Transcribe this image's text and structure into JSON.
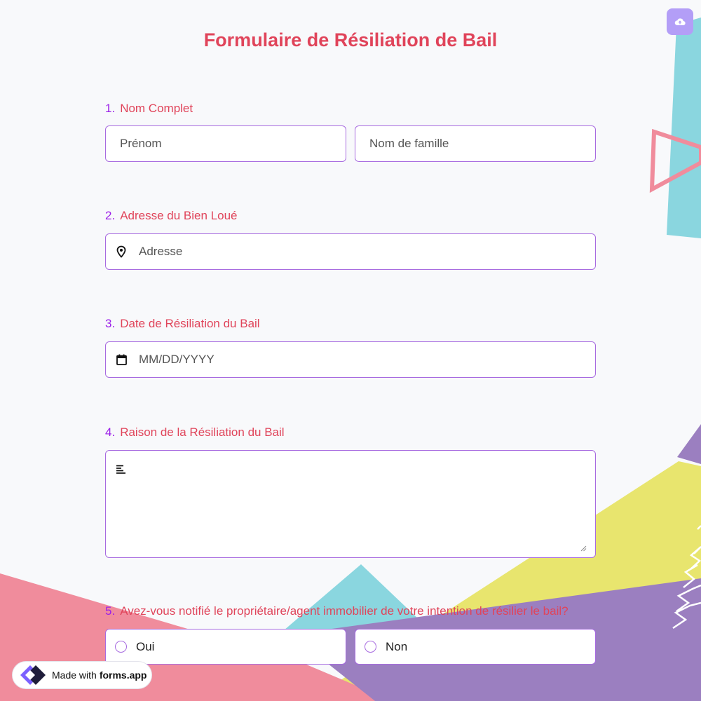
{
  "form": {
    "title": "Formulaire de Résiliation de Bail",
    "accent_color": "#e0445a",
    "number_color": "#9b1fe8",
    "border_color": "#a76be0"
  },
  "upload_button": {
    "icon": "cloud-upload-icon"
  },
  "questions": [
    {
      "number": "1.",
      "label": "Nom Complet",
      "fields": [
        {
          "placeholder": "Prénom"
        },
        {
          "placeholder": "Nom de famille"
        }
      ]
    },
    {
      "number": "2.",
      "label": "Adresse du Bien Loué",
      "field": {
        "icon": "location-pin-icon",
        "placeholder": "Adresse"
      }
    },
    {
      "number": "3.",
      "label": "Date de Résiliation du Bail",
      "field": {
        "icon": "calendar-icon",
        "placeholder": "MM/DD/YYYY"
      }
    },
    {
      "number": "4.",
      "label": "Raison de la Résiliation du Bail",
      "field": {
        "icon": "text-lines-icon",
        "placeholder": ""
      }
    },
    {
      "number": "5.",
      "label": "Avez-vous notifié le propriétaire/agent immobilier de votre intention de résilier le bail?",
      "options": [
        "Oui",
        "Non"
      ]
    }
  ],
  "badge": {
    "made_with": "Made with",
    "brand": "forms.app",
    "icon": "forms-app-logo-icon"
  },
  "background_colors": {
    "cyan": "#8ad6df",
    "pink": "#f08c9c",
    "yellow": "#e8e56e",
    "purple": "#9b7fc0"
  }
}
